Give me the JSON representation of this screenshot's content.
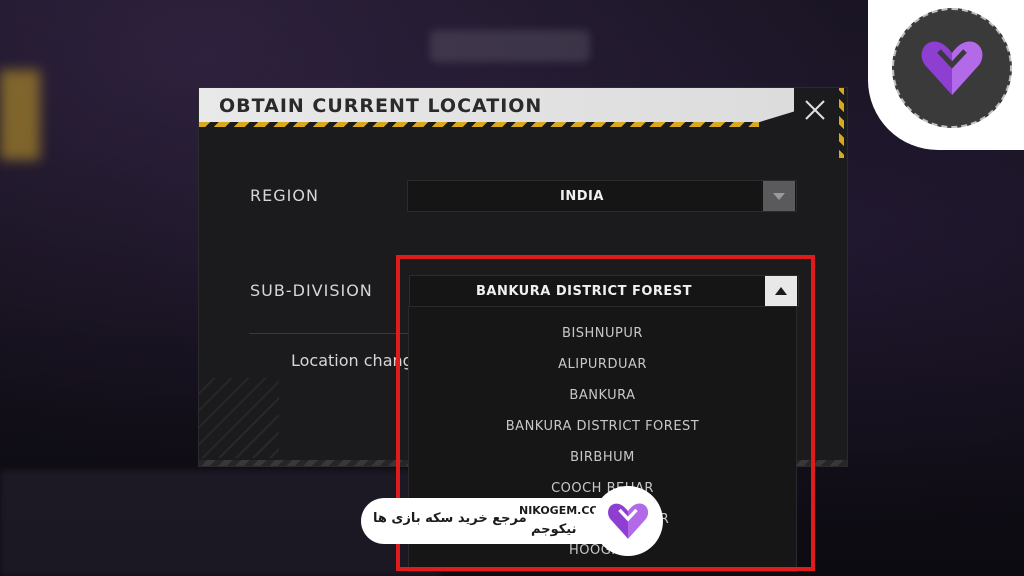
{
  "dialog": {
    "title": "OBTAIN CURRENT LOCATION",
    "close_icon": "close-icon"
  },
  "region": {
    "label": "REGION",
    "value": "INDIA"
  },
  "subdivision": {
    "label": "SUB-DIVISION",
    "value": "BANKURA DISTRICT FOREST",
    "options": [
      "BISHNUPUR",
      "ALIPURDUAR",
      "BANKURA",
      "BANKURA DISTRICT FOREST",
      "BIRBHUM",
      "COOCH BEHAR",
      "DAKSHIN DINAJPUR",
      "HOOGHLY"
    ]
  },
  "note": {
    "text": "Location chang"
  },
  "watermark": {
    "site": "NIKOGEM.COM",
    "tagline": "مرجع خرید سکه بازی ها",
    "brand": "نیکوجم"
  },
  "colors": {
    "highlight": "#e01b1b",
    "hazard": "#d8a91e",
    "brand_purple": "#8e3fd1"
  }
}
